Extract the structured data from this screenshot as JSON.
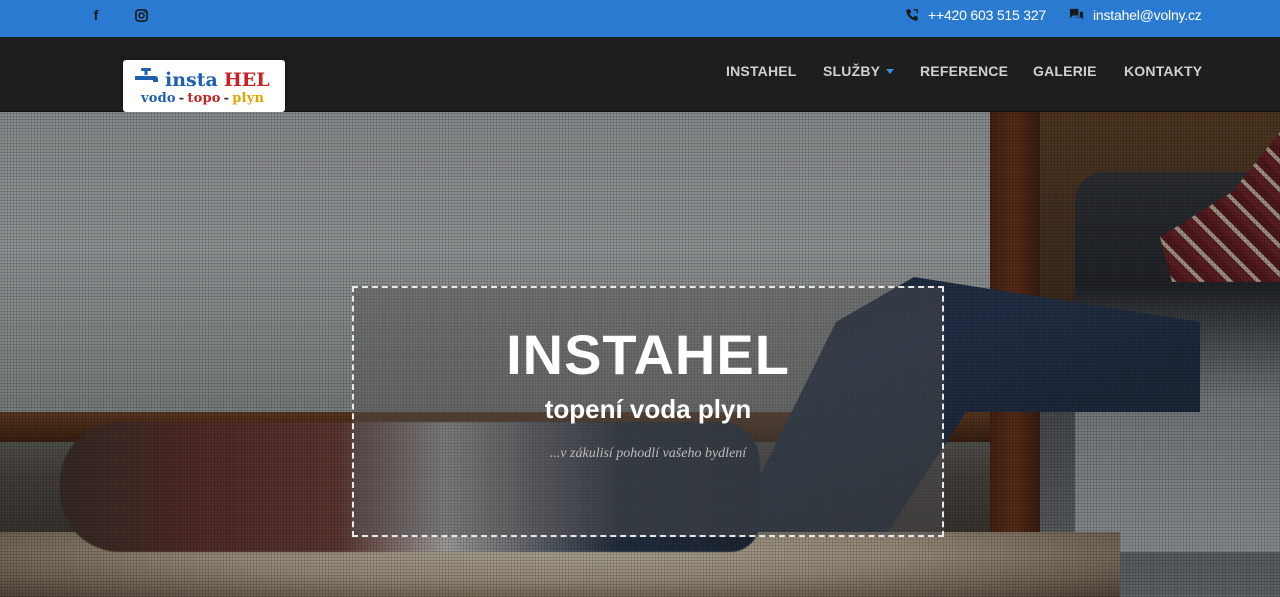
{
  "topbar": {
    "background": "#2a7ad2",
    "social": [
      {
        "icon": "facebook-icon",
        "glyph": "f"
      },
      {
        "icon": "instagram-icon"
      }
    ],
    "phone": "++420 603 515 327",
    "email": "instahel@volny.cz"
  },
  "navbar": {
    "logo": {
      "line1_a": "insta",
      "line1_b": "HEL",
      "line2": [
        "vodo",
        "topo",
        "plyn"
      ],
      "separator": "-"
    },
    "items": [
      {
        "label": "INSTAHEL"
      },
      {
        "label": "SLUŽBY",
        "dropdown": true
      },
      {
        "label": "REFERENCE"
      },
      {
        "label": "GALERIE"
      },
      {
        "label": "KONTAKTY"
      }
    ]
  },
  "hero": {
    "title": "INSTAHEL",
    "subtitle": "topení voda plyn",
    "tagline": "...v zákulisí pohodlí vašeho bydlení"
  },
  "colors": {
    "accent": "#2a7ad2",
    "navbar": "#1e1e1e",
    "logo_blue": "#1f5fb0",
    "logo_red": "#c62424",
    "logo_yellow": "#e0a500"
  }
}
